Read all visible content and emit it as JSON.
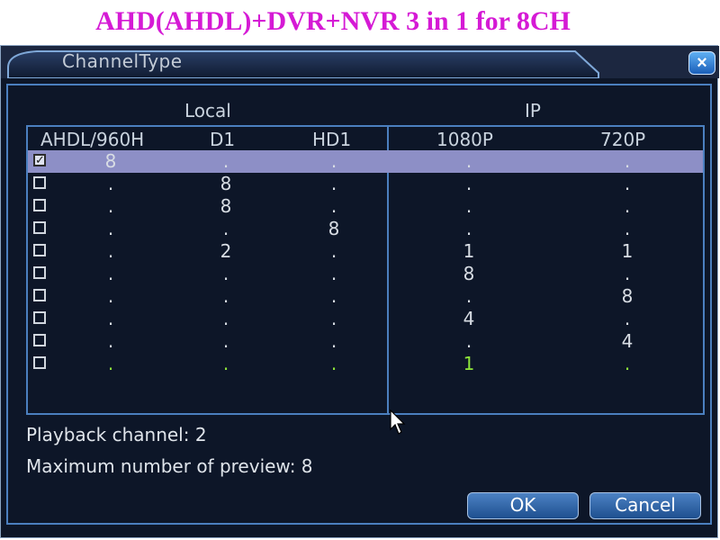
{
  "banner": {
    "text": "AHD(AHDL)+DVR+NVR 3 in 1 for 8CH"
  },
  "window": {
    "title": "ChannelType",
    "close_label": "×"
  },
  "groups": {
    "local": "Local",
    "ip": "IP"
  },
  "columns": [
    "AHDL/960H",
    "D1",
    "HD1",
    "1080P",
    "720P"
  ],
  "rows": [
    {
      "checked": true,
      "values": [
        "8",
        ".",
        ".",
        ".",
        "."
      ]
    },
    {
      "checked": false,
      "values": [
        ".",
        "8",
        ".",
        ".",
        "."
      ]
    },
    {
      "checked": false,
      "values": [
        ".",
        "8",
        ".",
        ".",
        "."
      ]
    },
    {
      "checked": false,
      "values": [
        ".",
        ".",
        "8",
        ".",
        "."
      ]
    },
    {
      "checked": false,
      "values": [
        ".",
        "2",
        ".",
        "1",
        "1"
      ]
    },
    {
      "checked": false,
      "values": [
        ".",
        ".",
        ".",
        "8",
        "."
      ]
    },
    {
      "checked": false,
      "values": [
        ".",
        ".",
        ".",
        ".",
        "8"
      ]
    },
    {
      "checked": false,
      "values": [
        ".",
        ".",
        ".",
        "4",
        "."
      ]
    },
    {
      "checked": false,
      "values": [
        ".",
        ".",
        ".",
        ".",
        "4"
      ]
    },
    {
      "checked": false,
      "values": [
        ".",
        ".",
        ".",
        "1",
        "."
      ]
    }
  ],
  "info": {
    "playback": "Playback channel: 2",
    "max_preview": "Maximum number of preview: 8"
  },
  "buttons": {
    "ok": "OK",
    "cancel": "Cancel"
  },
  "colors": {
    "banner": "#d51ad5",
    "remaining_row": "#8ee53a",
    "selected_row": "#8d8fc6",
    "border": "#4b7fbf"
  }
}
